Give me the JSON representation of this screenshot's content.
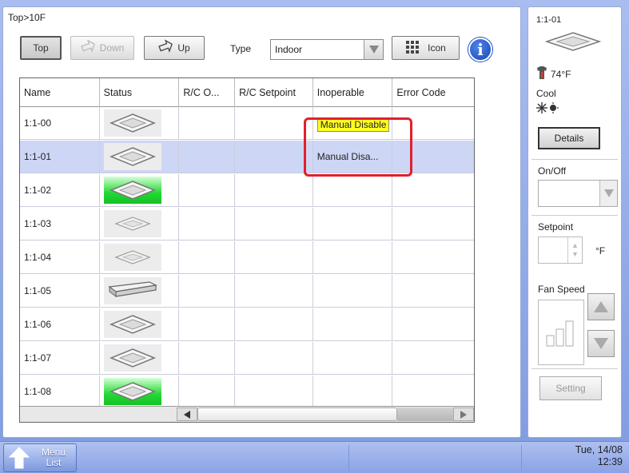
{
  "breadcrumb": "Top>10F",
  "toolbar": {
    "top_label": "Top",
    "down_label": "Down",
    "up_label": "Up",
    "type_label": "Type",
    "type_value": "Indoor",
    "icon_label": "Icon",
    "info_glyph": "i"
  },
  "table": {
    "headers": [
      "Name",
      "Status",
      "R/C O...",
      "R/C Setpoint",
      "Inoperable",
      "Error Code"
    ],
    "rows": [
      {
        "name": "1:1-00",
        "status_icon": "cassette-unit-icon",
        "active": false,
        "selected": false,
        "inoperable": "Manual Disable",
        "inoperable_highlight": true
      },
      {
        "name": "1:1-01",
        "status_icon": "cassette-unit-icon",
        "active": false,
        "selected": true,
        "inoperable": "Manual Disa...",
        "inoperable_highlight": false
      },
      {
        "name": "1:1-02",
        "status_icon": "cassette-unit-icon",
        "active": true,
        "selected": false,
        "inoperable": "",
        "inoperable_highlight": false
      },
      {
        "name": "1:1-03",
        "status_icon": "cassette-unit-icon",
        "active": false,
        "selected": false,
        "inoperable": "",
        "inoperable_highlight": false
      },
      {
        "name": "1:1-04",
        "status_icon": "cassette-unit-icon",
        "active": false,
        "selected": false,
        "inoperable": "",
        "inoperable_highlight": false
      },
      {
        "name": "1:1-05",
        "status_icon": "ceiling-suspended-unit-icon",
        "active": false,
        "selected": false,
        "inoperable": "",
        "inoperable_highlight": false
      },
      {
        "name": "1:1-06",
        "status_icon": "cassette-unit-icon",
        "active": false,
        "selected": false,
        "inoperable": "",
        "inoperable_highlight": false
      },
      {
        "name": "1:1-07",
        "status_icon": "cassette-unit-icon",
        "active": false,
        "selected": false,
        "inoperable": "",
        "inoperable_highlight": false
      },
      {
        "name": "1:1-08",
        "status_icon": "cassette-unit-icon",
        "active": true,
        "selected": false,
        "inoperable": "",
        "inoperable_highlight": false
      }
    ]
  },
  "side": {
    "unit_name": "1:1-01",
    "room_temp": "74°F",
    "mode": "Cool",
    "details_label": "Details",
    "onoff_label": "On/Off",
    "setpoint_label": "Setpoint",
    "setpoint_unit": "°F",
    "fan_label": "Fan Speed",
    "setting_label": "Setting"
  },
  "bottom": {
    "menu_label_line1": "Menu",
    "menu_label_line2": "List",
    "date": "Tue, 14/08",
    "time": "12:39"
  },
  "colors": {
    "highlight_box": "#e0202c",
    "disabled_badge": "#ffff20",
    "active_status": "#23d834",
    "selected_row": "#cdd6f5"
  }
}
